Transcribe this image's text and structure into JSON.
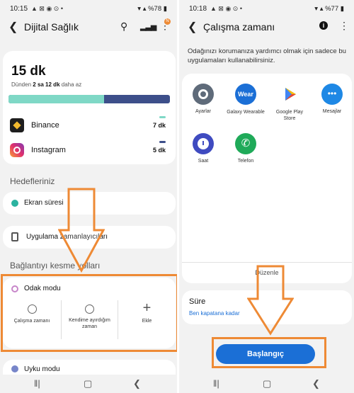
{
  "left": {
    "status": {
      "time": "10:15",
      "battery": "%78"
    },
    "title": "Dijital Sağlık",
    "badge": "N",
    "usage": {
      "total": "15 dk",
      "compare_prefix": "Dünden",
      "compare_value": "2 sa 12 dk",
      "compare_suffix": "daha az",
      "bar_fill_ratio": 0.59
    },
    "apps": [
      {
        "name": "Binance",
        "time": "7 dk"
      },
      {
        "name": "Instagram",
        "time": "5 dk"
      }
    ],
    "goals_heading": "Hedefleriniz",
    "screen_time": "Ekran süresi",
    "app_timers": "Uygulama zamanlayıcıları",
    "disconnect_heading": "Bağlantıyı kesme yolları",
    "focus_mode": {
      "title": "Odak modu",
      "options": [
        "Çalışma zamanı",
        "Kendime ayırdığım zaman",
        "Ekle"
      ]
    },
    "bedtime": "Uyku modu"
  },
  "right": {
    "status": {
      "time": "10:18",
      "battery": "%77"
    },
    "title": "Çalışma zamanı",
    "description": "Odağınızı korumanıza yardımcı olmak için sadece bu uygulamaları kullanabilirsiniz.",
    "apps": [
      {
        "name": "Ayarlar",
        "color": "#5f6b7a"
      },
      {
        "name": "Galaxy Wearable",
        "color": "#1b6fd6"
      },
      {
        "name": "Google Play Store",
        "color": "#ffffff"
      },
      {
        "name": "Mesajlar",
        "color": "#1e88e5"
      },
      {
        "name": "Saat",
        "color": "#3f4bc0"
      },
      {
        "name": "Telefon",
        "color": "#1faa59"
      }
    ],
    "edit": "Düzenle",
    "duration_title": "Süre",
    "duration_value": "Ben kapatana kadar",
    "start_button": "Başlangıç"
  },
  "colors": {
    "accent": "#ee8a35",
    "blue": "#1b6fd6",
    "teal": "#7fd8c6",
    "navy": "#3d4f8a"
  }
}
